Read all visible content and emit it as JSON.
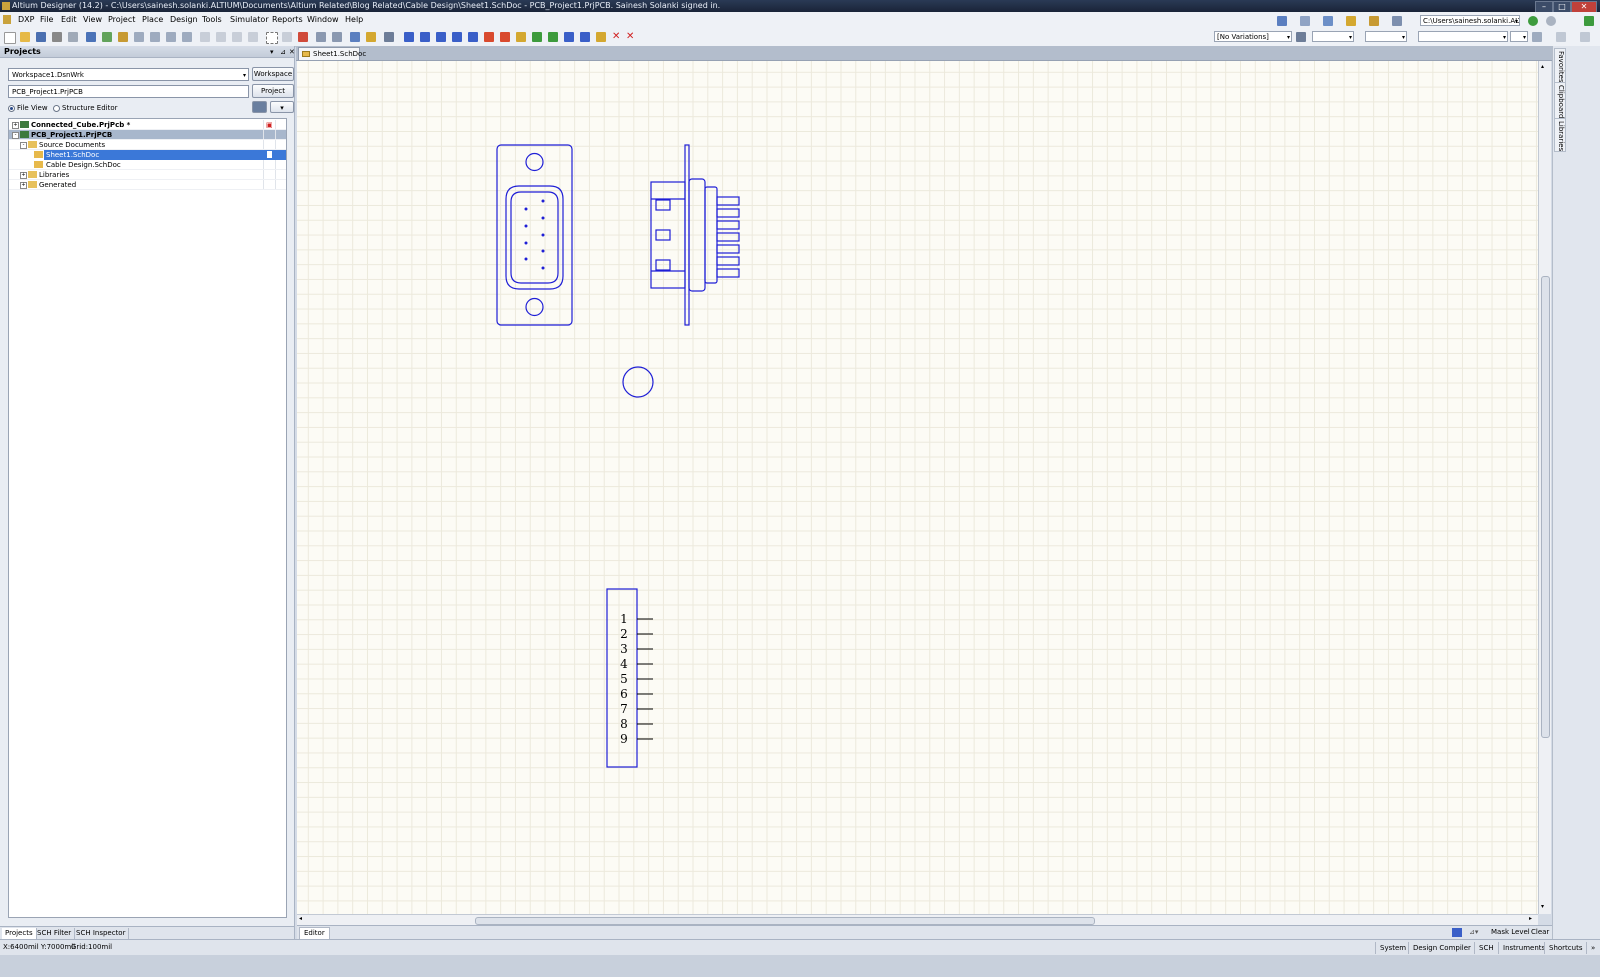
{
  "window": {
    "title": "Altium Designer (14.2) - C:\\Users\\sainesh.solanki.ALTIUM\\Documents\\Altium Related\\Blog Related\\Cable Design\\Sheet1.SchDoc - PCB_Project1.PrjPCB. Sainesh Solanki signed in."
  },
  "menu": {
    "items": [
      "DXP",
      "File",
      "Edit",
      "View",
      "Project",
      "Place",
      "Design",
      "Tools",
      "Simulator",
      "Reports",
      "Window",
      "Help"
    ],
    "path_combo": "C:\\Users\\sainesh.solanki.ALTIUM\\"
  },
  "toolbar": {
    "variations": "[No Variations]"
  },
  "projects_panel": {
    "title": "Projects",
    "workspace_value": "Workspace1.DsnWrk",
    "workspace_button": "Workspace",
    "project_value": "PCB_Project1.PrjPCB",
    "project_button": "Project",
    "view_file": "File View",
    "view_structure": "Structure Editor",
    "tree": [
      {
        "label": "Connected_Cube.PrjPcb *",
        "level": 0,
        "expander": "+",
        "bold": true,
        "selected": false
      },
      {
        "label": "PCB_Project1.PrjPCB",
        "level": 0,
        "expander": "-",
        "bold": true,
        "selected": "grey"
      },
      {
        "label": "Source Documents",
        "level": 1,
        "expander": "-",
        "bold": false,
        "selected": false
      },
      {
        "label": "Sheet1.SchDoc",
        "level": 2,
        "expander": "",
        "bold": false,
        "selected": "blue"
      },
      {
        "label": "Cable Design.SchDoc",
        "level": 2,
        "expander": "",
        "bold": false,
        "selected": false
      },
      {
        "label": "Libraries",
        "level": 1,
        "expander": "+",
        "bold": false,
        "selected": false
      },
      {
        "label": "Generated",
        "level": 1,
        "expander": "+",
        "bold": false,
        "selected": false
      }
    ],
    "bottom_tabs": [
      "Projects",
      "SCH Filter",
      "SCH Inspector"
    ]
  },
  "document": {
    "tab": "Sheet1.SchDoc",
    "pin_numbers": [
      "1",
      "2",
      "3",
      "4",
      "5",
      "6",
      "7",
      "8",
      "9"
    ],
    "stroke_color": "#1f1fd6"
  },
  "right_panels": [
    "Favorites",
    "Clipboard",
    "Libraries"
  ],
  "editor_bar": {
    "tab": "Editor",
    "mask_level": "Mask Level",
    "clear": "Clear"
  },
  "status": {
    "coords": "X:6400mil Y:7000mil",
    "grid": "Grid:100mil",
    "buttons": [
      "System",
      "Design Compiler",
      "SCH",
      "Instruments",
      "Shortcuts"
    ]
  }
}
